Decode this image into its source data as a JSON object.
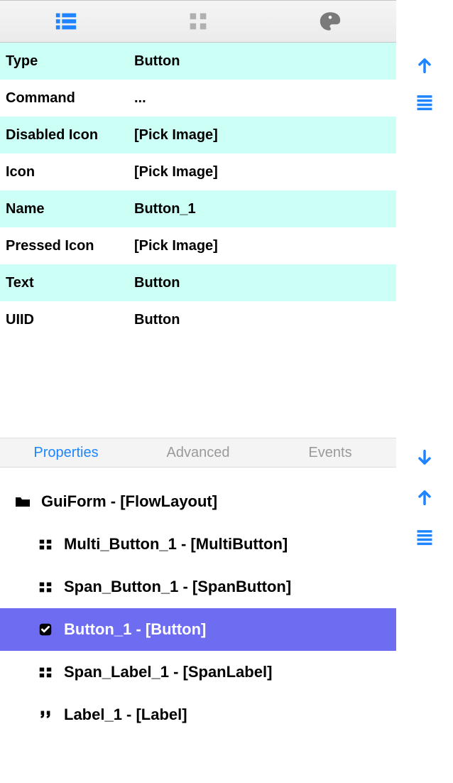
{
  "toolbar": {
    "view_list": "list-view",
    "view_grid": "grid-view",
    "view_palette": "palette-view"
  },
  "properties": [
    {
      "key": "Type",
      "value": "Button",
      "alt": true
    },
    {
      "key": "Command",
      "value": "...",
      "alt": false
    },
    {
      "key": "Disabled Icon",
      "value": "[Pick Image]",
      "alt": true
    },
    {
      "key": "Icon",
      "value": "[Pick Image]",
      "alt": false
    },
    {
      "key": "Name",
      "value": "Button_1",
      "alt": true
    },
    {
      "key": "Pressed Icon",
      "value": "[Pick Image]",
      "alt": false
    },
    {
      "key": "Text",
      "value": "Button",
      "alt": true
    },
    {
      "key": "UIID",
      "value": "Button",
      "alt": false
    }
  ],
  "subtabs": {
    "properties": "Properties",
    "advanced": "Advanced",
    "events": "Events"
  },
  "tree": [
    {
      "icon": "folder",
      "label": "GuiForm - [FlowLayout]",
      "indent": 0,
      "selected": false
    },
    {
      "icon": "grid",
      "label": "Multi_Button_1 - [MultiButton]",
      "indent": 1,
      "selected": false
    },
    {
      "icon": "grid",
      "label": "Span_Button_1 - [SpanButton]",
      "indent": 1,
      "selected": false
    },
    {
      "icon": "check",
      "label": "Button_1 - [Button]",
      "indent": 1,
      "selected": true
    },
    {
      "icon": "grid",
      "label": "Span_Label_1 - [SpanLabel]",
      "indent": 1,
      "selected": false
    },
    {
      "icon": "quote",
      "label": "Label_1 - [Label]",
      "indent": 1,
      "selected": false
    }
  ]
}
